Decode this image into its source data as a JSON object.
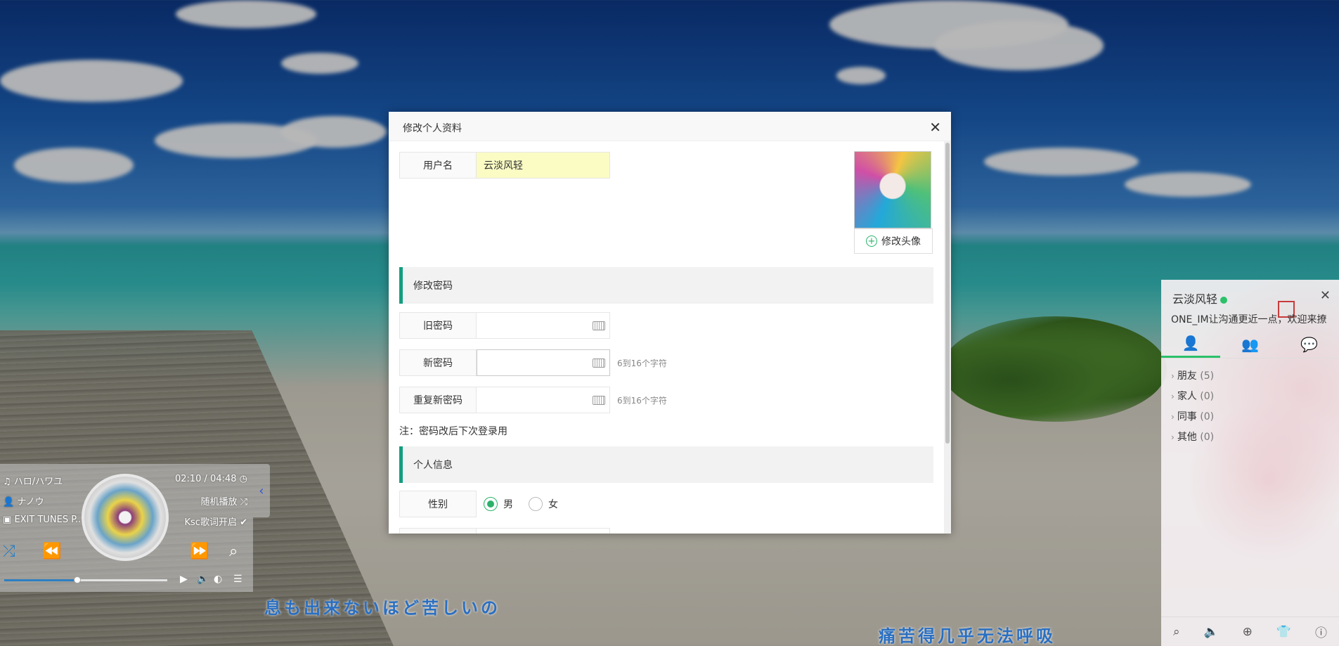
{
  "dialog": {
    "title": "修改个人资料",
    "username_label": "用户名",
    "username_value": "云淡风轻",
    "change_avatar": "修改头像",
    "section_password": "修改密码",
    "old_password_label": "旧密码",
    "new_password_label": "新密码",
    "new_password_hint": "6到16个字符",
    "repeat_password_label": "重复新密码",
    "repeat_password_hint": "6到16个字符",
    "password_note": "注：密码改后下次登录用",
    "section_personal": "个人信息",
    "gender_label": "性别",
    "gender_options": [
      "男",
      "女"
    ],
    "gender_selected": "男"
  },
  "player": {
    "song": "ハロ/ハワユ",
    "artist": "ナノウ",
    "album": "EXIT TUNES P...",
    "time": "02:10 / 04:48",
    "mode": "随机播放",
    "lyrics_toggle": "Ksc歌词开启",
    "progress": 0.45
  },
  "lyrics": {
    "line1": "息も出来ないほど苦しいの",
    "line2": "痛苦得几乎无法呼吸"
  },
  "im": {
    "name": "云淡风轻",
    "signature": "ONE_IM让沟通更近一点，欢迎来撩",
    "groups": [
      {
        "label": "朋友",
        "count": "(5)"
      },
      {
        "label": "家人",
        "count": "(0)"
      },
      {
        "label": "同事",
        "count": "(0)"
      },
      {
        "label": "其他",
        "count": "(0)"
      }
    ]
  },
  "colors": {
    "accent": "#139e7f",
    "online": "#2bc16a",
    "lyric": "#2a6fc1"
  }
}
